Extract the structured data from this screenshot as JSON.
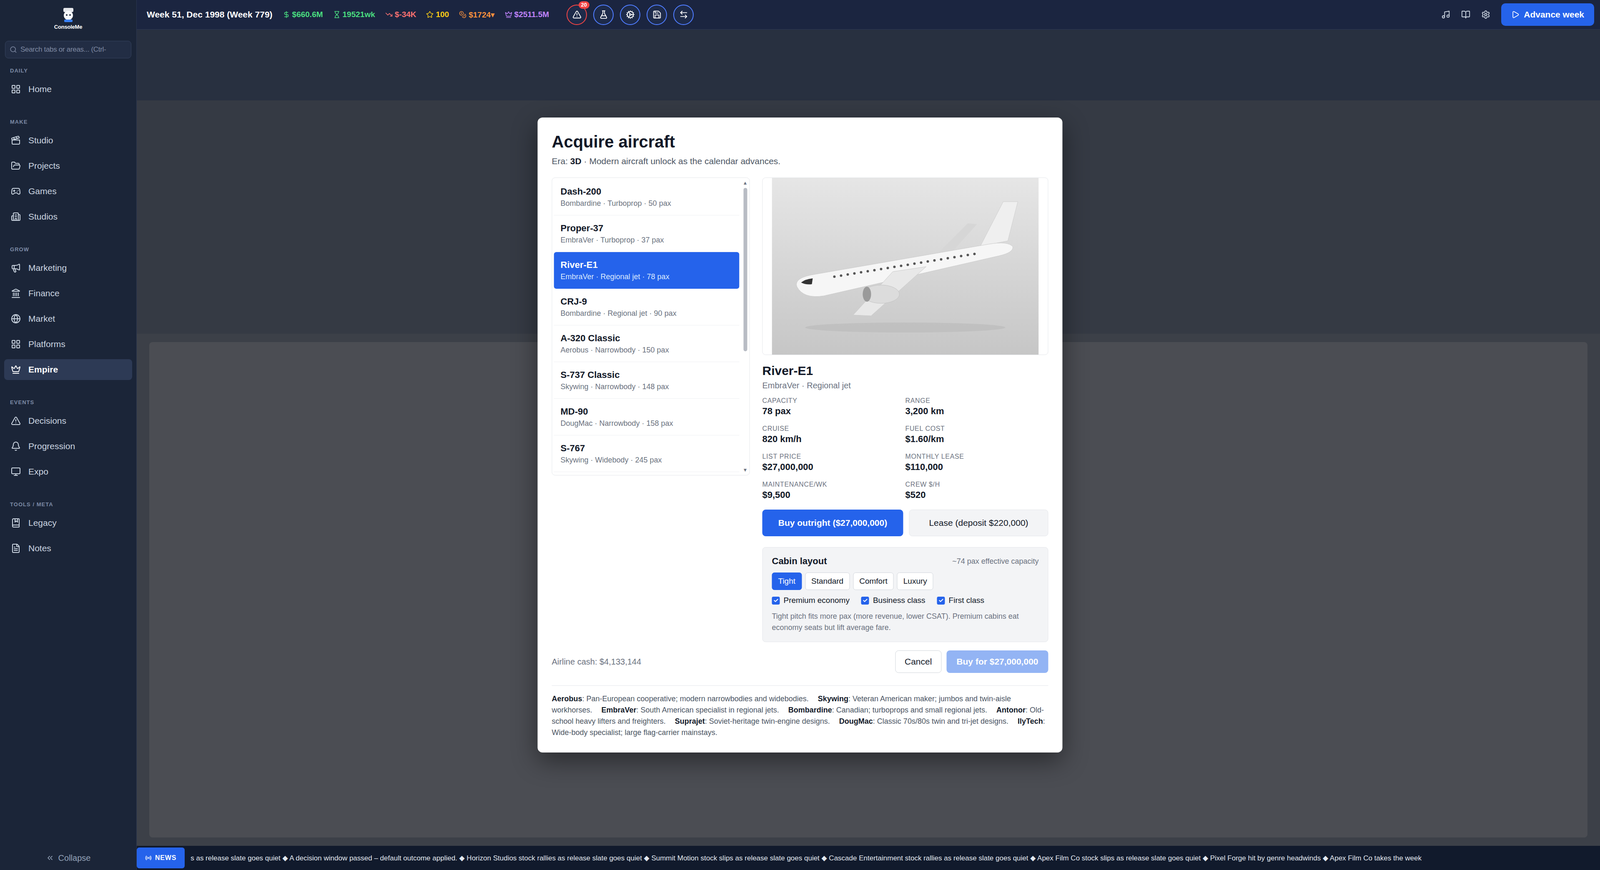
{
  "app": {
    "logo": "ConsoleMe"
  },
  "sidebar": {
    "search_placeholder": "Search tabs or areas... (Ctrl-",
    "sections": [
      {
        "label": "DAILY",
        "items": [
          {
            "label": "Home",
            "selected": false
          }
        ]
      },
      {
        "label": "MAKE",
        "items": [
          {
            "label": "Studio",
            "selected": false
          },
          {
            "label": "Projects",
            "selected": false
          },
          {
            "label": "Games",
            "selected": false
          },
          {
            "label": "Studios",
            "selected": false
          }
        ]
      },
      {
        "label": "GROW",
        "items": [
          {
            "label": "Marketing",
            "selected": false
          },
          {
            "label": "Finance",
            "selected": false
          },
          {
            "label": "Market",
            "selected": false
          },
          {
            "label": "Platforms",
            "selected": false
          },
          {
            "label": "Empire",
            "selected": true
          }
        ]
      },
      {
        "label": "EVENTS",
        "items": [
          {
            "label": "Decisions",
            "selected": false
          },
          {
            "label": "Progression",
            "selected": false
          },
          {
            "label": "Expo",
            "selected": false
          }
        ]
      },
      {
        "label": "TOOLS / META",
        "items": [
          {
            "label": "Legacy",
            "selected": false
          },
          {
            "label": "Notes",
            "selected": false
          }
        ]
      }
    ],
    "collapse": "Collapse"
  },
  "topbar": {
    "date": "Week 51, Dec 1998 (Week 779)",
    "stats": [
      {
        "value": "$660.6M",
        "color": "#4ade80"
      },
      {
        "value": "19521wk",
        "color": "#4ade80"
      },
      {
        "value": "$-34K",
        "color": "#f87171"
      },
      {
        "value": "100",
        "color": "#facc15"
      },
      {
        "value": "$1724▾",
        "color": "#fb923c"
      },
      {
        "value": "$2511.5M",
        "color": "#c084fc"
      }
    ],
    "tool_buttons": [
      {
        "alert": true,
        "badge": "20"
      },
      {
        "alert": false
      },
      {
        "alert": false
      },
      {
        "alert": false
      },
      {
        "alert": false
      }
    ],
    "advance": "Advance week"
  },
  "modal": {
    "title": "Acquire aircraft",
    "era_label": "Era:",
    "era": "3D",
    "era_note": "· Modern aircraft unlock as the calendar advances.",
    "aircraft": [
      {
        "name": "Dash-200",
        "detail": "Bombardine · Turboprop · 50 pax",
        "selected": false
      },
      {
        "name": "Proper-37",
        "detail": "EmbraVer · Turboprop · 37 pax",
        "selected": false
      },
      {
        "name": "River-E1",
        "detail": "EmbraVer · Regional jet · 78 pax",
        "selected": true
      },
      {
        "name": "CRJ-9",
        "detail": "Bombardine · Regional jet · 90 pax",
        "selected": false
      },
      {
        "name": "A-320 Classic",
        "detail": "Aerobus · Narrowbody · 150 pax",
        "selected": false
      },
      {
        "name": "S-737 Classic",
        "detail": "Skywing · Narrowbody · 148 pax",
        "selected": false
      },
      {
        "name": "MD-90",
        "detail": "DougMac · Narrowbody · 158 pax",
        "selected": false
      },
      {
        "name": "S-767",
        "detail": "Skywing · Widebody · 245 pax",
        "selected": false
      }
    ],
    "scrollbar": {
      "up": "▲",
      "down": "▼",
      "level": 0.59
    },
    "detail": {
      "name": "River-E1",
      "subtitle": "EmbraVer · Regional jet",
      "specs": [
        {
          "label": "CAPACITY",
          "value": "78 pax"
        },
        {
          "label": "RANGE",
          "value": "3,200 km"
        },
        {
          "label": "CRUISE",
          "value": "820 km/h"
        },
        {
          "label": "FUEL COST",
          "value": "$1.60/km"
        },
        {
          "label": "LIST PRICE",
          "value": "$27,000,000"
        },
        {
          "label": "MONTHLY LEASE",
          "value": "$110,000"
        },
        {
          "label": "MAINTENANCE/WK",
          "value": "$9,500"
        },
        {
          "label": "CREW $/H",
          "value": "$520"
        }
      ]
    },
    "purchase": [
      {
        "label": "Buy outright ($27,000,000)",
        "selected": true
      },
      {
        "label": "Lease (deposit $220,000)",
        "selected": false
      }
    ],
    "cabin": {
      "title": "Cabin layout",
      "capacity": "~74 pax effective capacity",
      "layouts": [
        {
          "label": "Tight",
          "selected": true
        },
        {
          "label": "Standard",
          "selected": false
        },
        {
          "label": "Comfort",
          "selected": false
        },
        {
          "label": "Luxury",
          "selected": false
        }
      ],
      "options": [
        {
          "label": "Premium economy",
          "checked": true
        },
        {
          "label": "Business class",
          "checked": true
        },
        {
          "label": "First class",
          "checked": true
        }
      ],
      "note": "Tight pitch fits more pax (more revenue, lower CSAT). Premium cabins eat economy seats but lift average fare."
    },
    "cash": "Airline cash: $4,133,144",
    "cancel": "Cancel",
    "confirm": {
      "label": "Buy for $27,000,000",
      "disabled": true
    },
    "makers": [
      {
        "name": "Aerobus",
        "description": ": Pan-European cooperative; modern narrowbodies and widebodies."
      },
      {
        "name": "Skywing",
        "description": ": Veteran American maker; jumbos and twin-aisle workhorses."
      },
      {
        "name": "EmbraVer",
        "description": ": South American specialist in regional jets."
      },
      {
        "name": "Bombardine",
        "description": ": Canadian; turboprops and small regional jets."
      },
      {
        "name": "Antonor",
        "description": ": Old-school heavy lifters and freighters."
      },
      {
        "name": "Suprajet",
        "description": ": Soviet-heritage twin-engine designs."
      },
      {
        "name": "DougMac",
        "description": ": Classic 70s/80s twin and tri-jet designs."
      },
      {
        "name": "IlyTech",
        "description": ": Wide-body specialist; large flag-carrier mainstays."
      }
    ]
  },
  "news": {
    "badge": "NEWS",
    "text": "s as release slate goes quiet ◆ A decision window passed – default outcome applied. ◆ Horizon Studios stock rallies as release slate goes quiet ◆ Summit Motion stock slips as release slate goes quiet ◆ Cascade Entertainment stock rallies as release slate goes quiet ◆ Apex Film Co stock slips as release slate goes quiet ◆ Pixel Forge hit by genre headwinds ◆ Apex Film Co takes the week"
  }
}
